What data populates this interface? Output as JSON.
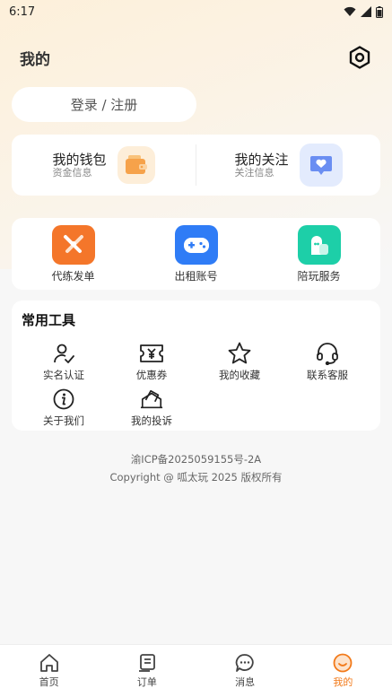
{
  "status_bar": {
    "time": "6:17"
  },
  "header": {
    "title": "我的"
  },
  "login": {
    "label": "登录 / 注册"
  },
  "wallet": {
    "left": {
      "title": "我的钱包",
      "subtitle": "资金信息"
    },
    "right": {
      "title": "我的关注",
      "subtitle": "关注信息"
    }
  },
  "services": [
    {
      "label": "代练发单",
      "color": "#f4762a"
    },
    {
      "label": "出租账号",
      "color": "#2f7cf6"
    },
    {
      "label": "陪玩服务",
      "color": "#1dcfa8"
    }
  ],
  "tools": {
    "title": "常用工具",
    "items": [
      {
        "label": "实名认证",
        "icon": "user-check-icon"
      },
      {
        "label": "优惠券",
        "icon": "coupon-icon"
      },
      {
        "label": "我的收藏",
        "icon": "star-icon"
      },
      {
        "label": "联系客服",
        "icon": "headset-icon"
      },
      {
        "label": "关于我们",
        "icon": "info-icon"
      },
      {
        "label": "我的投诉",
        "icon": "complaint-icon"
      }
    ]
  },
  "footer": {
    "icp": "渝ICP备2025059155号-2A",
    "copyright": "Copyright @ 呱太玩 2025 版权所有"
  },
  "tabbar": {
    "active_color": "#f27a1a",
    "items": [
      {
        "label": "首页"
      },
      {
        "label": "订单"
      },
      {
        "label": "消息"
      },
      {
        "label": "我的"
      }
    ]
  }
}
